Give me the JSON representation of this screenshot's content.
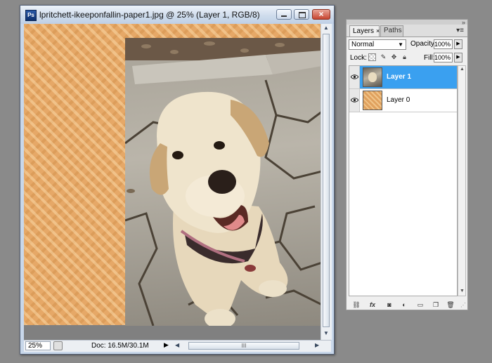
{
  "document_window": {
    "app_icon_text": "Ps",
    "title": "lpritchett-ikeeponfallin-paper1.jpg @ 25% (Layer 1, RGB/8)",
    "close_glyph": "×",
    "status": {
      "zoom": "25%",
      "doc_size": "Doc: 16.5M/30.1M",
      "arrow": "▶",
      "scroll_thumb_grip": "III"
    },
    "canvas": {
      "layers_shown": [
        "Layer 0 (houndstooth paper)",
        "Layer 1 (dog photo)"
      ]
    }
  },
  "layers_panel": {
    "tabs": [
      {
        "label": "Layers",
        "active": true,
        "close": "×"
      },
      {
        "label": "Paths",
        "active": false
      }
    ],
    "menu_glyph": "▾≡",
    "close_glyph": "»",
    "blend_mode": "Normal",
    "opacity_label": "Opacity:",
    "opacity_value": "100%",
    "lock_label": "Lock:",
    "fill_label": "Fill:",
    "fill_value": "100%",
    "layers": [
      {
        "name": "Layer 1",
        "selected": true,
        "visible": true,
        "thumbnail": "dog-photo"
      },
      {
        "name": "Layer 0",
        "selected": false,
        "visible": true,
        "thumbnail": "paper-texture"
      }
    ],
    "footer_icons": [
      "link-icon",
      "fx-icon",
      "mask-icon",
      "adjustment-icon",
      "group-icon",
      "new-layer-icon",
      "trash-icon"
    ],
    "footer_fx_text": "fx"
  },
  "colors": {
    "selection_blue": "#3aa0f0",
    "paper_orange": "#e6a867",
    "workspace_gray": "#8a8a8a"
  }
}
